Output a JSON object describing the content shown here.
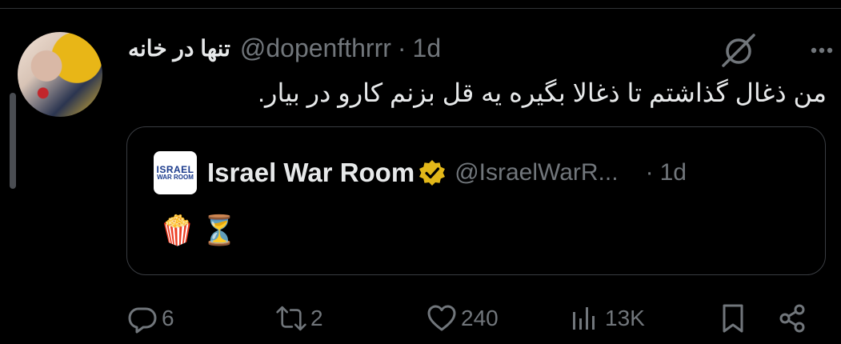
{
  "tweet": {
    "display_name": "تنها در خانه",
    "handle": "@dopenfthrrr",
    "separator": "·",
    "time": "1d",
    "text": "من ذغال گذاشتم تا ذغالا بگیره یه قل بزنم کارو در بیار."
  },
  "quoted": {
    "logo_line1": "ISRAEL",
    "logo_line2": "WAR ROOM",
    "display_name": "Israel War Room",
    "handle": "@IsraelWarR...",
    "separator": "·",
    "time": "1d",
    "emoji1": "🍿",
    "emoji2": "⏳"
  },
  "actions": {
    "replies": "6",
    "retweets": "2",
    "likes": "240",
    "views": "13K"
  },
  "colors": {
    "background": "#000000",
    "text": "#e7e9ea",
    "muted": "#71767b",
    "border": "#3a3d42",
    "verified_gold": "#e2b719"
  }
}
